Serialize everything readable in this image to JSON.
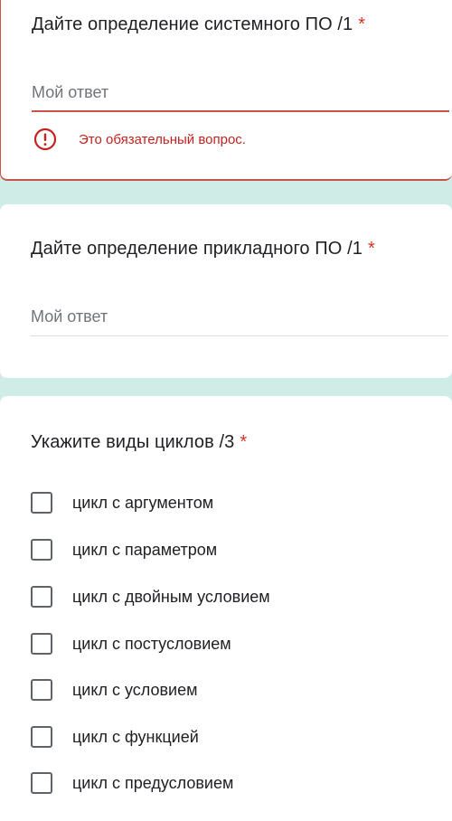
{
  "question1": {
    "title": "Дайте определение системного ПО /1",
    "required_mark": "*",
    "placeholder": "Мой ответ",
    "error_text": "Это обязательный вопрос."
  },
  "question2": {
    "title": "Дайте определение прикладного ПО /1",
    "required_mark": "*",
    "placeholder": "Мой ответ"
  },
  "question3": {
    "title": "Укажите виды циклов /3",
    "required_mark": "*",
    "options": [
      {
        "label": "цикл с аргументом",
        "checked": false
      },
      {
        "label": "цикл с параметром",
        "checked": false
      },
      {
        "label": "цикл с двойным условием",
        "checked": false
      },
      {
        "label": "цикл с постусловием",
        "checked": false
      },
      {
        "label": "цикл с условием",
        "checked": false
      },
      {
        "label": "цикл с функцией",
        "checked": false
      },
      {
        "label": "цикл с предусловием",
        "checked": false
      }
    ]
  },
  "colors": {
    "background": "#cfece6",
    "error": "#c5221f",
    "required": "#d93025"
  }
}
